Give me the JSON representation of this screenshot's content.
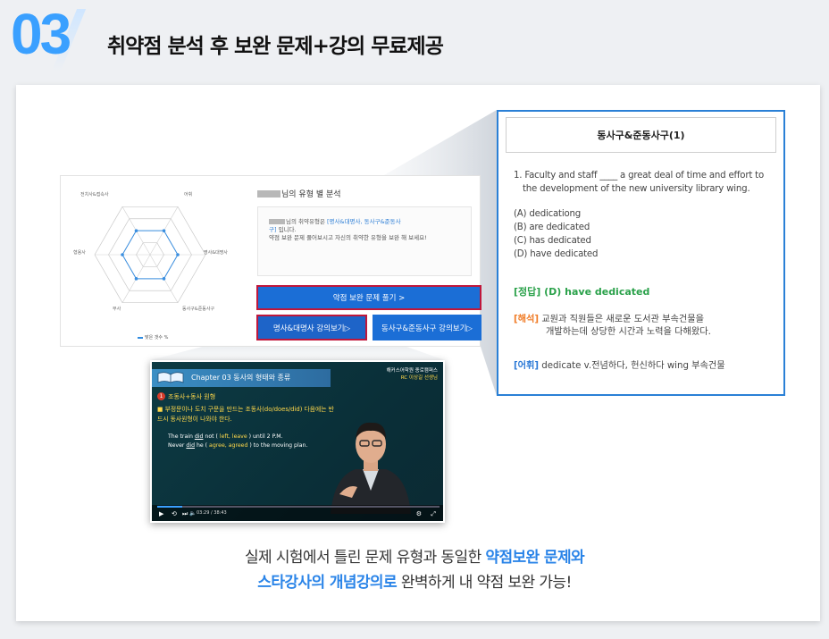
{
  "section": {
    "number": "03",
    "title": "취약점 분석 후 보완 문제+강의 무료제공"
  },
  "analysis": {
    "title_suffix": "님의 유형 별 분석",
    "radar_labels": [
      "전치사&접속사",
      "어휘",
      "명사&대명사",
      "동사구&준동사구",
      "부사",
      "형용사"
    ],
    "radar_values": [
      0.5,
      0.5,
      0.5,
      0.5,
      0.5,
      0.5
    ],
    "legend": "맞은 갯수 %",
    "result_line1_a": "님의 취약유형은 ",
    "result_line1_b": "[명사&대명사, 동사구&준동사",
    "result_line2_a": "구]",
    "result_line2_b": " 입니다.",
    "result_line3": "약점 보완 문제 풀어보시고 자신의 취약한 유형을 보완 해 보세요!",
    "btn_main": "약점 보완 문제 풀기 >",
    "btn_sub1": "명사&대명사 강의보기▷",
    "btn_sub2": "동사구&준동사구 강의보기▷"
  },
  "question": {
    "header": "동사구&준동사구(1)",
    "stem": "1. Faculty and staff ____ a great deal of time and effort to the development of the new university library wing.",
    "options": [
      "(A) dedicationg",
      "(B) are dedicated",
      "(C) has dedicated",
      "(D) have dedicated"
    ],
    "answer": "[정답] (D) have dedicated",
    "explain_tag": "[해석]",
    "explain_text": "교원과 직원들은 새로운 도서관 부속건물을",
    "explain_text2": "개발하는데 상당한 시간과 노력을 다해왔다.",
    "vocab_tag": "[어휘]",
    "vocab_text": " dedicate v.전념하다, 헌신하다 wing 부속건물"
  },
  "video": {
    "chapter": "Chapter 03 동사의 형태와 종류",
    "brand": "해커스어학원 종로캠퍼스",
    "teacher": "RC 이상길 선생님",
    "point_num": "1",
    "point_title": "조동사+동사 원형",
    "point_body": "■ 부정문이나 도치 구문을 만드는 조동사(do/does/did) 다음에는 반드시 동사원형이 나와야 한다.",
    "ex1_a": "The train ",
    "ex1_b": "did",
    "ex1_c": " not ( ",
    "ex1_d": "left, leave",
    "ex1_e": " ) until 2 P.M.",
    "ex2_a": "Never ",
    "ex2_b": "did",
    "ex2_c": " he ( ",
    "ex2_d": "agree, agreed",
    "ex2_e": " ) to the moving plan.",
    "time": "03:29 / 38:43",
    "progress": 0.09
  },
  "caption": {
    "l1_a": "실제 시험에서 틀린 문제 유형과 동일한 ",
    "l1_b": "약점보완 문제와",
    "l2_a": "스타강사의 개념강의로",
    "l2_b": " 완벽하게 내 약점 보완 가능!"
  },
  "colors": {
    "accent": "#2a84e8",
    "answer": "#2aa14a",
    "explain": "#f07a24",
    "highlight_border": "#c0173b"
  }
}
